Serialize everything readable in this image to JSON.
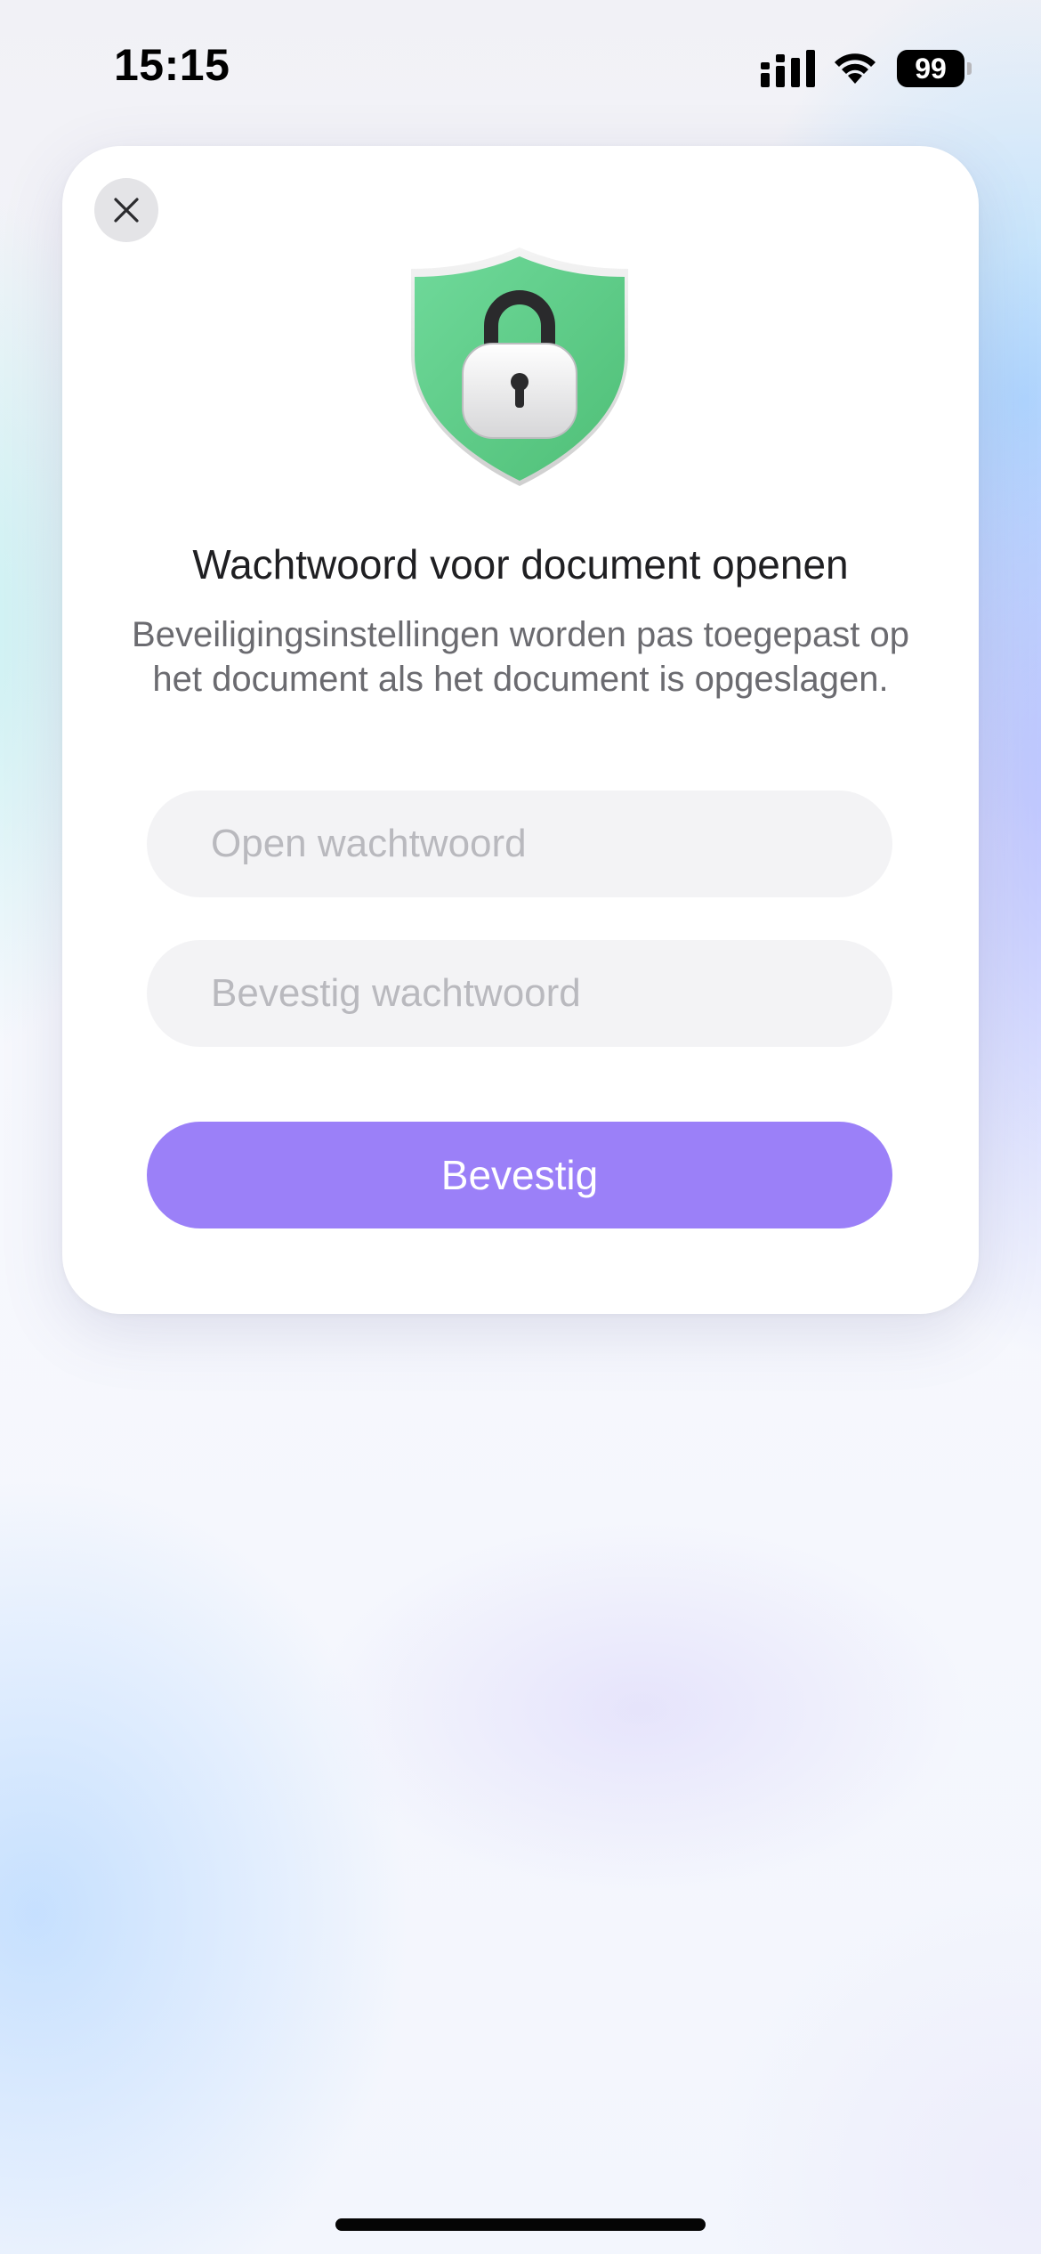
{
  "status_bar": {
    "time": "15:15",
    "battery_level": "99",
    "icons": [
      "cellular-signal-icon",
      "wifi-icon",
      "battery-icon"
    ]
  },
  "dialog": {
    "close_icon": "close-icon",
    "illustration": "shield-lock-icon",
    "title": "Wachtwoord voor document openen",
    "description": "Beveiligingsinstellingen worden pas toegepast op het document als het document is opgeslagen.",
    "open_password": {
      "value": "",
      "placeholder": "Open wachtwoord"
    },
    "confirm_password": {
      "value": "",
      "placeholder": "Bevestig wachtwoord"
    },
    "confirm_button_label": "Bevestig"
  },
  "colors": {
    "accent_button": "#9b80f8",
    "shield_green": "#5fcf85",
    "field_background": "#f3f3f5"
  }
}
